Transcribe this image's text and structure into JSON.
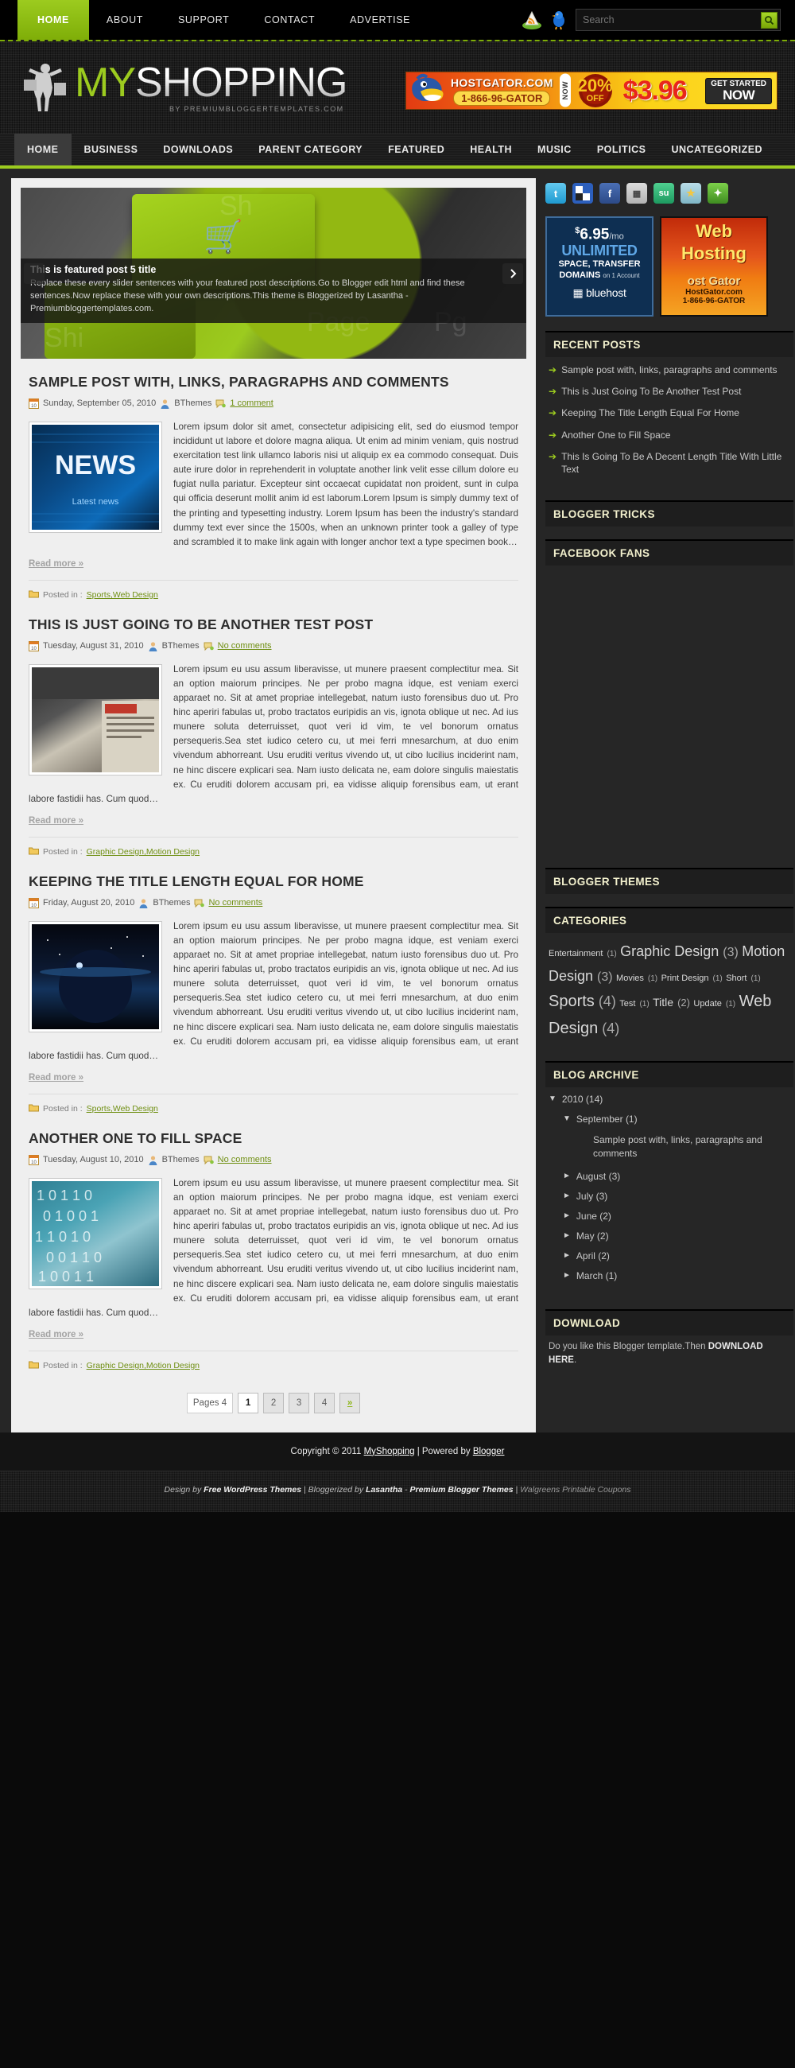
{
  "topbar": {
    "nav": [
      {
        "label": "HOME",
        "active": true
      },
      {
        "label": "ABOUT",
        "active": false
      },
      {
        "label": "SUPPORT",
        "active": false
      },
      {
        "label": "CONTACT",
        "active": false
      },
      {
        "label": "ADVERTISE",
        "active": false
      }
    ],
    "rss_icon": "rss-icon",
    "twitter_icon": "twitter-bird-icon",
    "search": {
      "placeholder": "Search",
      "value": "",
      "button_icon": "search-icon"
    }
  },
  "header": {
    "logo_mark": "shopping-girl-icon",
    "logo_my": "MY",
    "logo_shopping": "SHOPPING",
    "logo_sub": "BY PREMIUMBLOGGERTEMPLATES.COM",
    "banner": {
      "domain": "HOSTGATOR.COM",
      "phone": "1-866-96-GATOR",
      "now": "NOW",
      "percent": "20%",
      "off": "OFF",
      "price": "$3.96",
      "cta_line1": "GET STARTED",
      "cta_line2": "NOW"
    }
  },
  "mainnav": [
    {
      "label": "HOME",
      "active": true
    },
    {
      "label": "BUSINESS",
      "active": false
    },
    {
      "label": "DOWNLOADS",
      "active": false
    },
    {
      "label": "PARENT CATEGORY",
      "active": false
    },
    {
      "label": "FEATURED",
      "active": false
    },
    {
      "label": "HEALTH",
      "active": false
    },
    {
      "label": "MUSIC",
      "active": false
    },
    {
      "label": "POLITICS",
      "active": false
    },
    {
      "label": "UNCATEGORIZED",
      "active": false
    }
  ],
  "slider": {
    "title": "This is featured post 5 title",
    "description": "Replace these every slider sentences with your featured post descriptions.Go to Blogger edit html and find these sentences.Now replace these with your own descriptions.This theme is Bloggerized by Lasantha - Premiumbloggertemplates.com.",
    "prev_icon": "chevron-left-icon",
    "next_icon": "chevron-right-icon"
  },
  "posts": [
    {
      "title": "SAMPLE POST WITH, LINKS, PARAGRAPHS AND COMMENTS",
      "date": "Sunday, September 05, 2010",
      "author": "BThemes",
      "comments": "1 comment",
      "body": "Lorem ipsum dolor sit amet, consectetur adipisicing elit, sed do eiusmod tempor incididunt ut labore et dolore magna aliqua. Ut enim ad minim veniam, quis nostrud exercitation test link ullamco laboris nisi ut aliquip ex ea commodo consequat. Duis aute irure dolor in reprehenderit in voluptate another link velit esse cillum dolore eu fugiat nulla pariatur. Excepteur sint occaecat cupidatat non proident, sunt in culpa qui officia deserunt mollit anim id est laborum.Lorem Ipsum is simply dummy text of the printing and typesetting industry. Lorem Ipsum has been the industry's standard dummy text ever since the 1500s, when an unknown printer took a galley of type and scrambled it to make link again with longer anchor text a type specimen book…",
      "read_more": "Read more »",
      "posted_in_label": "Posted in :",
      "categories": "Sports,Web Design",
      "thumb": "news-image"
    },
    {
      "title": "THIS IS JUST GOING TO BE ANOTHER TEST POST",
      "date": "Tuesday, August 31, 2010",
      "author": "BThemes",
      "comments": "No comments",
      "body": "Lorem ipsum eu usu assum liberavisse, ut munere praesent complectitur mea. Sit an option maiorum principes. Ne per probo magna idque, est veniam exerci apparaet no. Sit at amet propriae intellegebat, natum iusto forensibus duo ut. Pro hinc aperiri fabulas ut, probo tractatos euripidis an vis, ignota oblique ut nec. Ad ius munere soluta deterruisset, quot veri id vim, te vel bonorum ornatus persequeris.Sea stet iudico cetero cu, ut mei ferri mnesarchum, at duo enim vivendum abhorreant. Usu eruditi veritus vivendo ut, ut cibo lucilius inciderint nam, ne hinc discere explicari sea. Nam iusto delicata ne, eam dolore singulis maiestatis ex. Cu eruditi dolorem accusam pri, ea vidisse aliquip forensibus eam, ut erant labore fastidii has. Cum quod…",
      "read_more": "Read more »",
      "posted_in_label": "Posted in :",
      "categories": "Graphic Design,Motion Design",
      "thumb": "newspaper-image"
    },
    {
      "title": "KEEPING THE TITLE LENGTH EQUAL FOR HOME",
      "date": "Friday, August 20, 2010",
      "author": "BThemes",
      "comments": "No comments",
      "body": "Lorem ipsum eu usu assum liberavisse, ut munere praesent complectitur mea. Sit an option maiorum principes. Ne per probo magna idque, est veniam exerci apparaet no. Sit at amet propriae intellegebat, natum iusto forensibus duo ut. Pro hinc aperiri fabulas ut, probo tractatos euripidis an vis, ignota oblique ut nec. Ad ius munere soluta deterruisset, quot veri id vim, te vel bonorum ornatus persequeris.Sea stet iudico cetero cu, ut mei ferri mnesarchum, at duo enim vivendum abhorreant. Usu eruditi veritus vivendo ut, ut cibo lucilius inciderint nam, ne hinc discere explicari sea. Nam iusto delicata ne, eam dolore singulis maiestatis ex. Cu eruditi dolorem accusam pri, ea vidisse aliquip forensibus eam, ut erant labore fastidii has. Cum quod…",
      "read_more": "Read more »",
      "posted_in_label": "Posted in :",
      "categories": "Sports,Web Design",
      "thumb": "space-image"
    },
    {
      "title": "ANOTHER ONE TO FILL SPACE",
      "date": "Tuesday, August 10, 2010",
      "author": "BThemes",
      "comments": "No comments",
      "body": "Lorem ipsum eu usu assum liberavisse, ut munere praesent complectitur mea. Sit an option maiorum principes. Ne per probo magna idque, est veniam exerci apparaet no. Sit at amet propriae intellegebat, natum iusto forensibus duo ut. Pro hinc aperiri fabulas ut, probo tractatos euripidis an vis, ignota oblique ut nec. Ad ius munere soluta deterruisset, quot veri id vim, te vel bonorum ornatus persequeris.Sea stet iudico cetero cu, ut mei ferri mnesarchum, at duo enim vivendum abhorreant. Usu eruditi veritus vivendo ut, ut cibo lucilius inciderint nam, ne hinc discere explicari sea. Nam iusto delicata ne, eam dolore singulis maiestatis ex. Cu eruditi dolorem accusam pri, ea vidisse aliquip forensibus eam, ut erant labore fastidii has. Cum quod…",
      "read_more": "Read more »",
      "posted_in_label": "Posted in :",
      "categories": "Graphic Design,Motion Design",
      "thumb": "binary-image"
    }
  ],
  "pager": {
    "label": "Pages 4",
    "pages": [
      "1",
      "2",
      "3",
      "4"
    ],
    "current": "1",
    "next": "»"
  },
  "sidebar": {
    "social": [
      {
        "name": "twitter-icon",
        "glyph": "t",
        "color": "#3ab3e0"
      },
      {
        "name": "delicious-icon",
        "glyph": "",
        "color": "#2c5fbd"
      },
      {
        "name": "facebook-icon",
        "glyph": "f",
        "color": "#3b5998"
      },
      {
        "name": "bookmark-icon",
        "glyph": "▦",
        "color": "#b9b9b9"
      },
      {
        "name": "stumbleupon-icon",
        "glyph": "su",
        "color": "#2ea66b"
      },
      {
        "name": "favorites-star-icon",
        "glyph": "★",
        "color": "#8fc6d6"
      },
      {
        "name": "add-share-icon",
        "glyph": "✦",
        "color": "#56a832"
      }
    ],
    "ad_bluehost": {
      "price": "6.95",
      "currency": "$",
      "per": "/mo",
      "line1": "UNLIMITED",
      "line2": "SPACE, TRANSFER",
      "line3": "DOMAINS",
      "line3_small": "on 1 Account",
      "brand": "bluehost"
    },
    "ad_hostgator": {
      "line1": "Web",
      "line2": "Hosting",
      "brand": "ost Gator",
      "url": "HostGator.com",
      "phone": "1-866-96-GATOR"
    },
    "widgets": [
      {
        "title": "RECENT POSTS"
      },
      {
        "title": "BLOGGER TRICKS"
      },
      {
        "title": "FACEBOOK FANS"
      },
      {
        "title": "BLOGGER THEMES"
      },
      {
        "title": "CATEGORIES"
      },
      {
        "title": "BLOG ARCHIVE"
      },
      {
        "title": "DOWNLOAD"
      }
    ],
    "recent_posts": [
      "Sample post with, links, paragraphs and comments",
      "This is Just Going To Be Another Test Post",
      "Keeping The Title Length Equal For Home",
      "Another One to Fill Space",
      "This Is Going To Be A Decent Length Title With Little Text"
    ],
    "categories": [
      {
        "label": "Entertainment",
        "count": "(1)",
        "size": 11
      },
      {
        "label": "Graphic Design",
        "count": "(3)",
        "size": 18
      },
      {
        "label": "Motion Design",
        "count": "(3)",
        "size": 18
      },
      {
        "label": "Movies",
        "count": "(1)",
        "size": 11
      },
      {
        "label": "Print Design",
        "count": "(1)",
        "size": 11
      },
      {
        "label": "Short",
        "count": "(1)",
        "size": 11
      },
      {
        "label": "Sports",
        "count": "(4)",
        "size": 20
      },
      {
        "label": "Test",
        "count": "(1)",
        "size": 11
      },
      {
        "label": "Title",
        "count": "(2)",
        "size": 14
      },
      {
        "label": "Update",
        "count": "(1)",
        "size": 11
      },
      {
        "label": "Web Design",
        "count": "(4)",
        "size": 20
      }
    ],
    "archive": {
      "year": "2010 (14)",
      "open_month": "September (1)",
      "open_post": "Sample post with, links, paragraphs and comments",
      "months": [
        "August (3)",
        "July (3)",
        "June (2)",
        "May (2)",
        "April (2)",
        "March (1)"
      ],
      "open_icon": "triangle-down-icon",
      "closed_icon": "triangle-right-icon"
    },
    "download": {
      "text": "Do you like this Blogger template.Then ",
      "link": "DOWNLOAD HERE",
      "period": "."
    }
  },
  "footer": {
    "copyright_pre": "Copyright © 2011 ",
    "copyright_site": "MyShopping",
    "copyright_mid": " | Powered by ",
    "copyright_platform": "Blogger",
    "credits_pre": "Design by ",
    "credits_a": "Free WordPress Themes",
    "credits_mid": " | Bloggerized by ",
    "credits_b": "Lasantha",
    "credits_dash": " - ",
    "credits_c": "Premium Blogger Themes",
    "credits_end": " | ",
    "credits_d": "Walgreens Printable Coupons"
  }
}
